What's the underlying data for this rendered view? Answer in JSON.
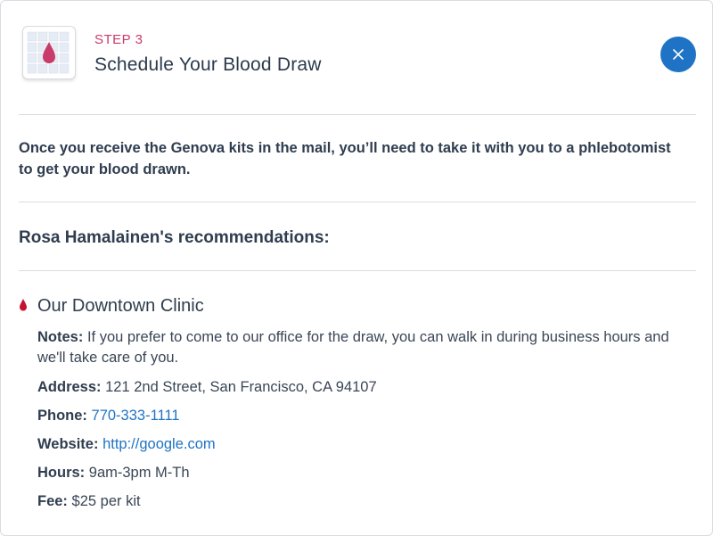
{
  "step": {
    "label": "STEP 3",
    "title": "Schedule Your Blood Draw",
    "icon": "calendar-blood-drop-icon",
    "accent_color": "#c83b6a"
  },
  "close_button": {
    "icon": "close-icon",
    "color": "#1f73c4"
  },
  "intro_text": "Once you receive the Genova kits in the mail, you’ll need to take it with you to a phlebotomist to get your blood drawn.",
  "recommendations_heading": "Rosa Hamalainen's recommendations:",
  "clinic": {
    "name": "Our Downtown Clinic",
    "bullet_icon": "blood-drop-icon",
    "notes_label": "Notes:",
    "notes": "If you prefer to come to our office for the draw, you can walk in during business hours and we'll take care of you.",
    "address_label": "Address:",
    "address": "121 2nd Street, San Francisco, CA 94107",
    "phone_label": "Phone:",
    "phone": "770-333-1111",
    "website_label": "Website:",
    "website": "http://google.com",
    "hours_label": "Hours:",
    "hours": "9am-3pm M-Th",
    "fee_label": "Fee:",
    "fee": "$25 per kit"
  },
  "link_color": "#1f73c4"
}
